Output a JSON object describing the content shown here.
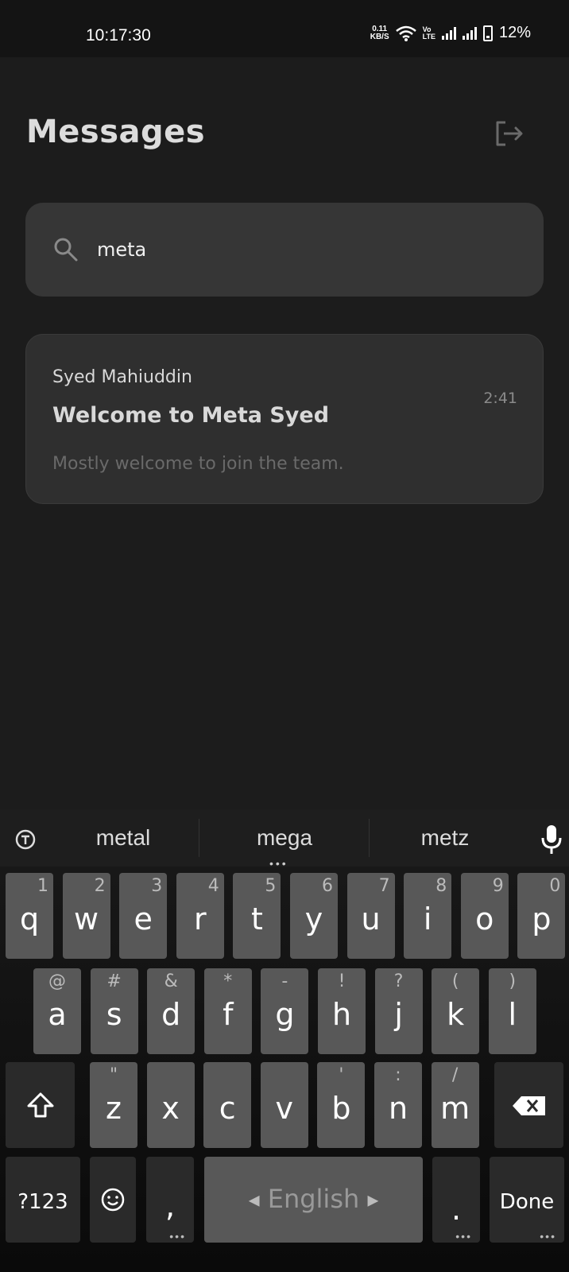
{
  "status_bar": {
    "time": "10:17:30",
    "net_speed_value": "0.11",
    "net_speed_unit": "KB/S",
    "volte_top": "Vo",
    "volte_bottom": "LTE",
    "battery": "12%"
  },
  "header": {
    "title": "Messages",
    "logout_icon": "logout-icon"
  },
  "search": {
    "value": "meta",
    "icon": "search-icon"
  },
  "messages": [
    {
      "sender": "Syed Mahiuddin",
      "subject": "Welcome to Meta Syed",
      "time": "2:41",
      "preview": "Mostly welcome to join the team."
    }
  ],
  "keyboard": {
    "suggestions": [
      "metal",
      "mega",
      "metz"
    ],
    "row1": [
      {
        "key": "q",
        "hint": "1"
      },
      {
        "key": "w",
        "hint": "2"
      },
      {
        "key": "e",
        "hint": "3"
      },
      {
        "key": "r",
        "hint": "4"
      },
      {
        "key": "t",
        "hint": "5"
      },
      {
        "key": "y",
        "hint": "6"
      },
      {
        "key": "u",
        "hint": "7"
      },
      {
        "key": "i",
        "hint": "8"
      },
      {
        "key": "o",
        "hint": "9"
      },
      {
        "key": "p",
        "hint": "0"
      }
    ],
    "row2": [
      {
        "key": "a",
        "hint": "@"
      },
      {
        "key": "s",
        "hint": "#"
      },
      {
        "key": "d",
        "hint": "&"
      },
      {
        "key": "f",
        "hint": "*"
      },
      {
        "key": "g",
        "hint": "-"
      },
      {
        "key": "h",
        "hint": "!"
      },
      {
        "key": "j",
        "hint": "?"
      },
      {
        "key": "k",
        "hint": "("
      },
      {
        "key": "l",
        "hint": ")"
      }
    ],
    "row3": [
      {
        "key": "z",
        "hint": "\""
      },
      {
        "key": "x",
        "hint": ""
      },
      {
        "key": "c",
        "hint": ""
      },
      {
        "key": "v",
        "hint": ""
      },
      {
        "key": "b",
        "hint": "'"
      },
      {
        "key": "n",
        "hint": ":"
      },
      {
        "key": "m",
        "hint": "/"
      }
    ],
    "symbols_label": "?123",
    "comma": ",",
    "space_label": "English",
    "period": ".",
    "done_label": "Done",
    "colors": {
      "key": "#585858",
      "dark_key": "#2a2a2a"
    }
  }
}
